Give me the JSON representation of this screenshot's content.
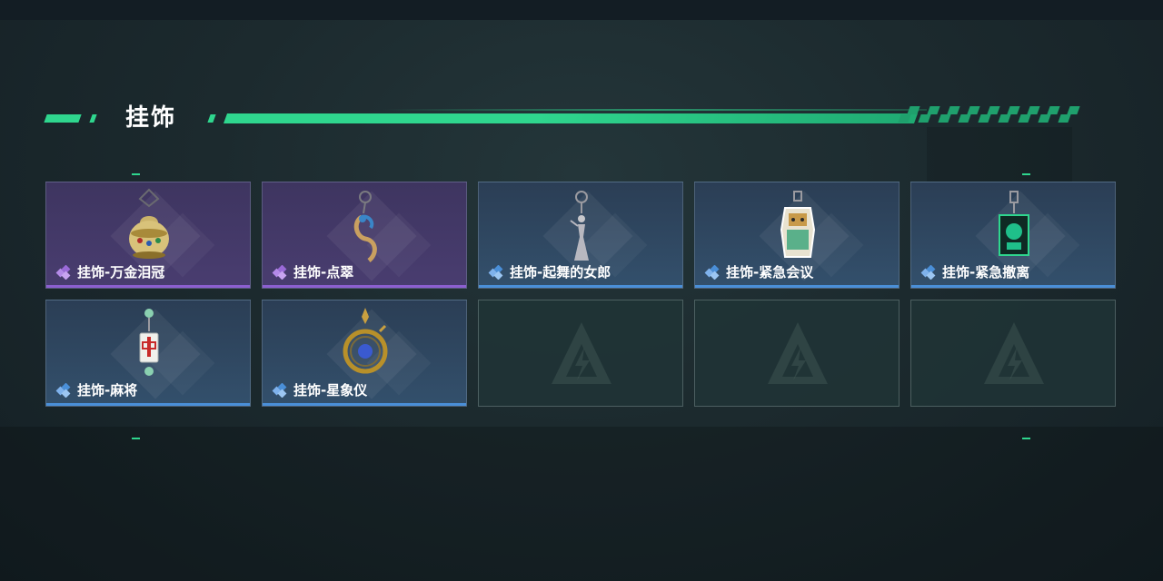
{
  "section": {
    "title": "挂饰"
  },
  "colors": {
    "accent": "#2fd68e",
    "rarity_purple": "#8c5fd0",
    "rarity_blue": "#4a8fd8"
  },
  "items": [
    {
      "label": "挂饰-万金泪冠",
      "rarity": "purple",
      "icon": "golden-egg-charm-icon"
    },
    {
      "label": "挂饰-点翠",
      "rarity": "purple",
      "icon": "phoenix-hairpin-charm-icon"
    },
    {
      "label": "挂饰-起舞的女郎",
      "rarity": "blue",
      "icon": "dancing-lady-charm-icon"
    },
    {
      "label": "挂饰-紧急会议",
      "rarity": "blue",
      "icon": "robot-sticker-charm-icon"
    },
    {
      "label": "挂饰-紧急撤离",
      "rarity": "blue",
      "icon": "green-panel-charm-icon"
    },
    {
      "label": "挂饰-麻将",
      "rarity": "blue",
      "icon": "mahjong-tile-charm-icon"
    },
    {
      "label": "挂饰-星象仪",
      "rarity": "blue",
      "icon": "astrolabe-charm-icon"
    },
    {
      "label": "",
      "rarity": "empty",
      "icon": "empty-slot-logo-icon"
    },
    {
      "label": "",
      "rarity": "empty",
      "icon": "empty-slot-logo-icon"
    },
    {
      "label": "",
      "rarity": "empty",
      "icon": "empty-slot-logo-icon"
    }
  ]
}
